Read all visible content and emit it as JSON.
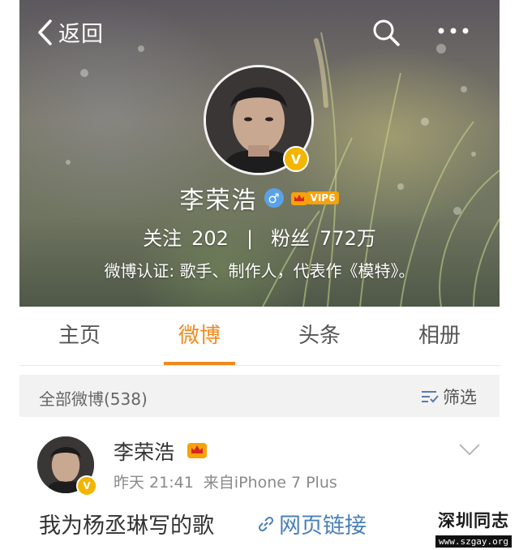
{
  "nav": {
    "back_label": "返回"
  },
  "profile": {
    "name": "李荣浩",
    "gender_symbol": "♂",
    "vip_label": "VIP6",
    "verified_mark": "V",
    "follow_label": "关注",
    "follow_count": "202",
    "separator": "|",
    "fans_label": "粉丝",
    "fans_count": "772万",
    "verification_text": "微博认证: 歌手、制作人，代表作《模特》。"
  },
  "tabs": [
    {
      "label": "主页",
      "active": false
    },
    {
      "label": "微博",
      "active": true
    },
    {
      "label": "头条",
      "active": false
    },
    {
      "label": "相册",
      "active": false
    }
  ],
  "filter_bar": {
    "all_label": "全部微博(538)",
    "filter_label": "筛选"
  },
  "post": {
    "author": "李荣浩",
    "verified_mark": "V",
    "time": "昨天 21:41",
    "source": "来自iPhone 7 Plus",
    "text": "我为杨丞琳写的歌",
    "link_label": "网页链接"
  },
  "watermark": {
    "title": "深圳同志",
    "url": "www.szgay.org"
  },
  "colors": {
    "accent": "#ef8a1f",
    "link": "#4a7fb8",
    "verified": "#f2b500",
    "gender": "#5aa2e8"
  }
}
